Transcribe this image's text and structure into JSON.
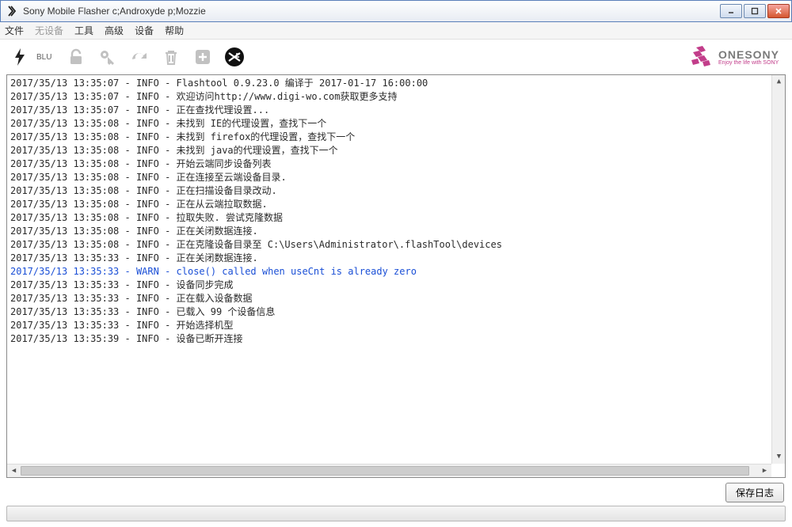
{
  "window": {
    "title": "Sony Mobile Flasher c;Androxyde p;Mozzie"
  },
  "menu": {
    "items": [
      {
        "label": "文件",
        "enabled": true
      },
      {
        "label": "无设备",
        "enabled": false
      },
      {
        "label": "工具",
        "enabled": true
      },
      {
        "label": "高级",
        "enabled": true
      },
      {
        "label": "设备",
        "enabled": true
      },
      {
        "label": "帮助",
        "enabled": true
      }
    ]
  },
  "toolbar": {
    "blu_label": "BLU"
  },
  "brand": {
    "name": "ONESONY",
    "tagline": "Enjoy the life with SONY"
  },
  "logs": [
    {
      "ts": "2017/35/13 13:35:07",
      "lvl": "INFO",
      "msg": "Flashtool  0.9.23.0 编译于 2017-01-17 16:00:00"
    },
    {
      "ts": "2017/35/13 13:35:07",
      "lvl": "INFO",
      "msg": "欢迎访问http://www.digi-wo.com获取更多支持"
    },
    {
      "ts": "2017/35/13 13:35:07",
      "lvl": "INFO",
      "msg": "正在查找代理设置..."
    },
    {
      "ts": "2017/35/13 13:35:08",
      "lvl": "INFO",
      "msg": "未找到 IE的代理设置，查找下一个"
    },
    {
      "ts": "2017/35/13 13:35:08",
      "lvl": "INFO",
      "msg": "未找到 firefox的代理设置，查找下一个"
    },
    {
      "ts": "2017/35/13 13:35:08",
      "lvl": "INFO",
      "msg": "未找到 java的代理设置，查找下一个"
    },
    {
      "ts": "2017/35/13 13:35:08",
      "lvl": "INFO",
      "msg": "开始云端同步设备列表"
    },
    {
      "ts": "2017/35/13 13:35:08",
      "lvl": "INFO",
      "msg": "正在连接至云端设备目录."
    },
    {
      "ts": "2017/35/13 13:35:08",
      "lvl": "INFO",
      "msg": "正在扫描设备目录改动."
    },
    {
      "ts": "2017/35/13 13:35:08",
      "lvl": "INFO",
      "msg": "正在从云端拉取数据."
    },
    {
      "ts": "2017/35/13 13:35:08",
      "lvl": "INFO",
      "msg": "拉取失败. 尝试克隆数据"
    },
    {
      "ts": "2017/35/13 13:35:08",
      "lvl": "INFO",
      "msg": "正在关闭数据连接."
    },
    {
      "ts": "2017/35/13 13:35:08",
      "lvl": "INFO",
      "msg": "正在克隆设备目录至  C:\\Users\\Administrator\\.flashTool\\devices"
    },
    {
      "ts": "2017/35/13 13:35:33",
      "lvl": "INFO",
      "msg": "正在关闭数据连接."
    },
    {
      "ts": "2017/35/13 13:35:33",
      "lvl": "WARN",
      "msg": "close() called when useCnt is already zero"
    },
    {
      "ts": "2017/35/13 13:35:33",
      "lvl": "INFO",
      "msg": "设备同步完成"
    },
    {
      "ts": "2017/35/13 13:35:33",
      "lvl": "INFO",
      "msg": "正在载入设备数据"
    },
    {
      "ts": "2017/35/13 13:35:33",
      "lvl": "INFO",
      "msg": "已载入 99 个设备信息"
    },
    {
      "ts": "2017/35/13 13:35:33",
      "lvl": "INFO",
      "msg": "开始选择机型"
    },
    {
      "ts": "2017/35/13 13:35:39",
      "lvl": "INFO",
      "msg": "设备已断开连接"
    }
  ],
  "buttons": {
    "save_log": "保存日志"
  }
}
